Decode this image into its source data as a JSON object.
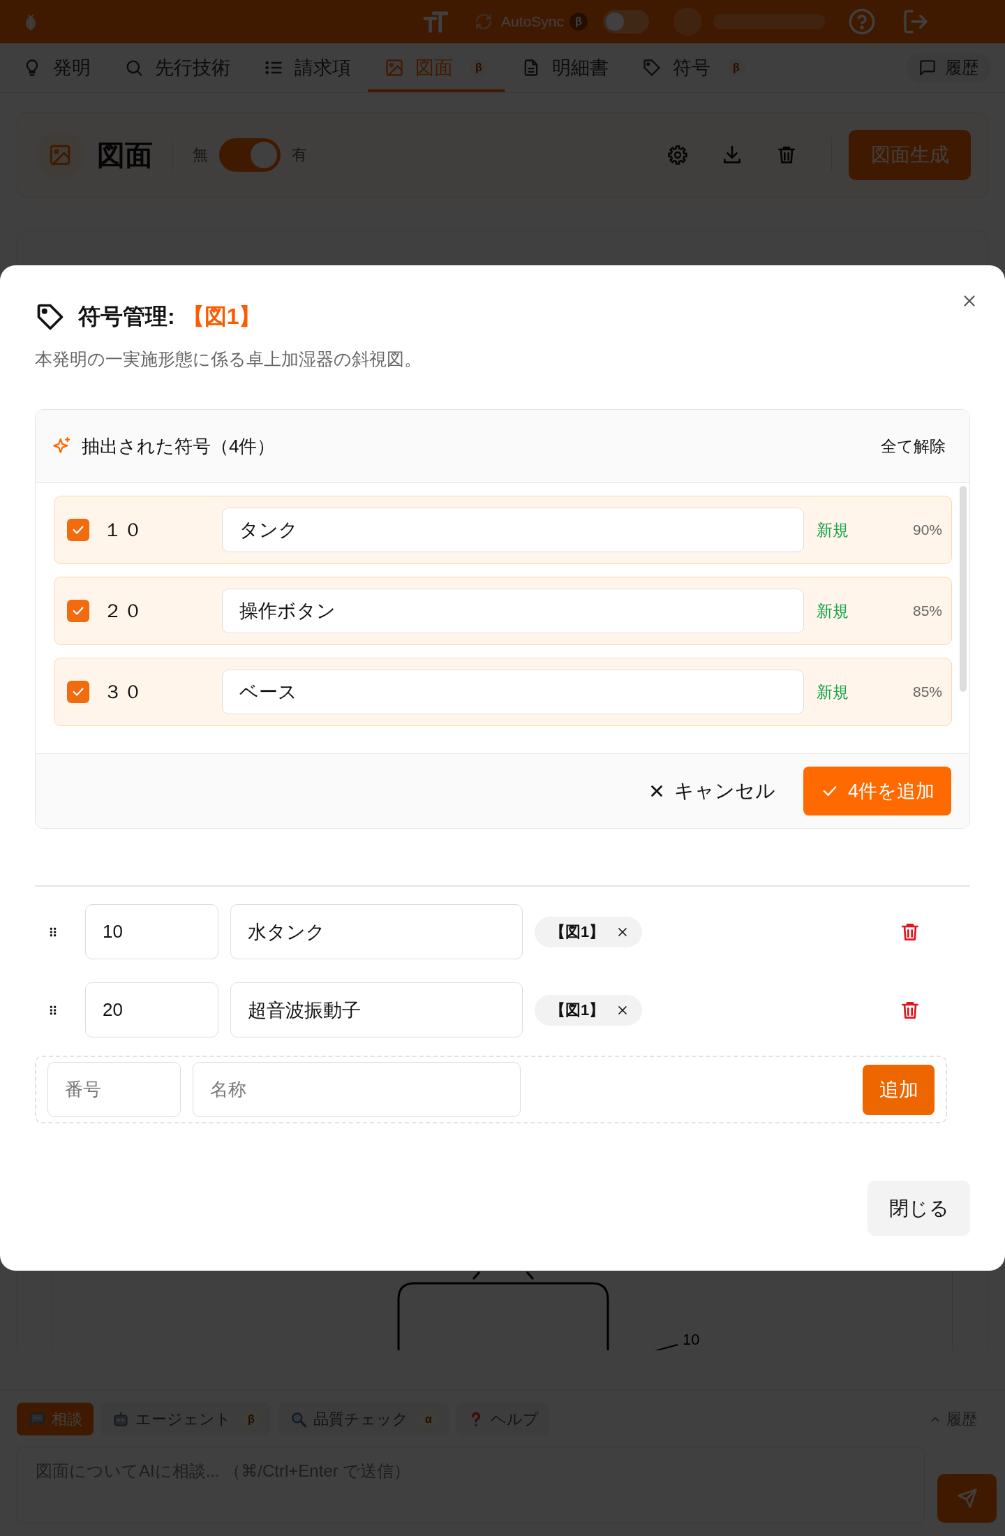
{
  "top_bar": {
    "autosync_label": "AutoSync",
    "autosync_badge": "β",
    "autosync_on": false
  },
  "nav_tabs": [
    {
      "label": "発明",
      "selected": false
    },
    {
      "label": "先行技術",
      "selected": false
    },
    {
      "label": "請求項",
      "selected": false
    },
    {
      "label": "図面",
      "badge": "β",
      "selected": true
    },
    {
      "label": "明細書",
      "selected": false
    },
    {
      "label": "符号",
      "badge": "β",
      "selected": false
    }
  ],
  "history_button": "履歴",
  "drawing_header": {
    "title": "図面",
    "toggle_off_label": "無",
    "toggle_on_label": "有",
    "toggle_on": true,
    "generate_button": "図面生成"
  },
  "figure_drawing": {
    "reference_label": "10"
  },
  "modal": {
    "title": "符号管理:",
    "figure_ref": "【図1】",
    "description": "本発明の一実施形態に係る卓上加湿器の斜視図。",
    "extracted": {
      "title": "抽出された符号（4件）",
      "clear_all": "全て解除",
      "candidates": [
        {
          "checked": true,
          "number": "１０",
          "name": "タンク",
          "status": "新規",
          "confidence": "90%"
        },
        {
          "checked": true,
          "number": "２０",
          "name": "操作ボタン",
          "status": "新規",
          "confidence": "85%"
        },
        {
          "checked": true,
          "number": "３０",
          "name": "ベース",
          "status": "新規",
          "confidence": "85%"
        }
      ],
      "cancel_button": "キャンセル",
      "add_button": "4件を追加"
    },
    "symbols": [
      {
        "number": "10",
        "name": "水タンク",
        "figures": [
          "【図1】"
        ]
      },
      {
        "number": "20",
        "name": "超音波振動子",
        "figures": [
          "【図1】"
        ]
      }
    ],
    "new_symbol": {
      "number_placeholder": "番号",
      "name_placeholder": "名称",
      "add_button": "追加"
    },
    "close_button": "閉じる"
  },
  "assistant": {
    "tabs": [
      {
        "label": "相談",
        "selected": true
      },
      {
        "label": "エージェント",
        "badge": "β",
        "selected": false
      },
      {
        "label": "品質チェック",
        "badge": "α",
        "selected": false
      },
      {
        "label": "ヘルプ",
        "selected": false
      }
    ],
    "history_button": "履歴",
    "input": {
      "placeholder": "図面についてAIに相談... （⌘/Ctrl+Enter で送信）"
    }
  }
}
